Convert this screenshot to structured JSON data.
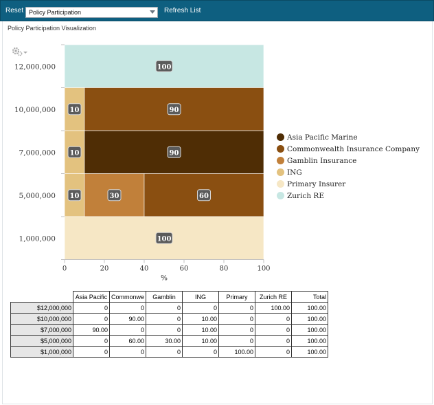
{
  "toolbar": {
    "reset_label": "Reset",
    "select_value": "Policy Participation",
    "refresh_label": "Refresh List"
  },
  "panel": {
    "title": "Policy Participation Visualization"
  },
  "colors": {
    "toolbar_bg": "#0e5f80",
    "Asia Pacific Marine": "#4f2d05",
    "Commonwealth Insurance Company": "#8a4f11",
    "Gamblin Insurance": "#c1803a",
    "ING": "#e3c27f",
    "Primary Insurer": "#f6e7c5",
    "Zurich RE": "#c7e7e3"
  },
  "chart_data": {
    "type": "bar",
    "orientation": "horizontal",
    "stacked": true,
    "xlabel": "%",
    "ylabel": "",
    "xlim": [
      0,
      100
    ],
    "xticks": [
      "0",
      "20",
      "40",
      "60",
      "80",
      "100"
    ],
    "categories": [
      "12,000,000",
      "10,000,000",
      "7,000,000",
      "5,000,000",
      "1,000,000"
    ],
    "series": [
      {
        "name": "Asia Pacific Marine",
        "values": [
          0,
          0,
          90,
          0,
          0
        ]
      },
      {
        "name": "Commonwealth Insurance Company",
        "values": [
          0,
          90,
          0,
          60,
          0
        ]
      },
      {
        "name": "Gamblin Insurance",
        "values": [
          0,
          0,
          0,
          30,
          0
        ]
      },
      {
        "name": "ING",
        "values": [
          0,
          10,
          10,
          10,
          0
        ]
      },
      {
        "name": "Primary Insurer",
        "values": [
          0,
          0,
          0,
          0,
          100
        ]
      },
      {
        "name": "Zurich RE",
        "values": [
          100,
          0,
          0,
          0,
          0
        ]
      }
    ],
    "legend_position": "right",
    "grid": false,
    "data_labels": true
  },
  "table": {
    "headers": [
      "Asia Pacific",
      "Commonwe",
      "Gamblin",
      "ING",
      "Primary",
      "Zurich RE",
      "Total"
    ],
    "rows": [
      {
        "label": "$12,000,000",
        "cells": [
          "0",
          "0",
          "0",
          "0",
          "0",
          "100.00",
          "100.00"
        ]
      },
      {
        "label": "$10,000,000",
        "cells": [
          "0",
          "90.00",
          "0",
          "10.00",
          "0",
          "0",
          "100.00"
        ]
      },
      {
        "label": "$7,000,000",
        "cells": [
          "90.00",
          "0",
          "0",
          "10.00",
          "0",
          "0",
          "100.00"
        ]
      },
      {
        "label": "$5,000,000",
        "cells": [
          "0",
          "60.00",
          "30.00",
          "10.00",
          "0",
          "0",
          "100.00"
        ]
      },
      {
        "label": "$1,000,000",
        "cells": [
          "0",
          "0",
          "0",
          "0",
          "100.00",
          "0",
          "100.00"
        ]
      }
    ]
  }
}
